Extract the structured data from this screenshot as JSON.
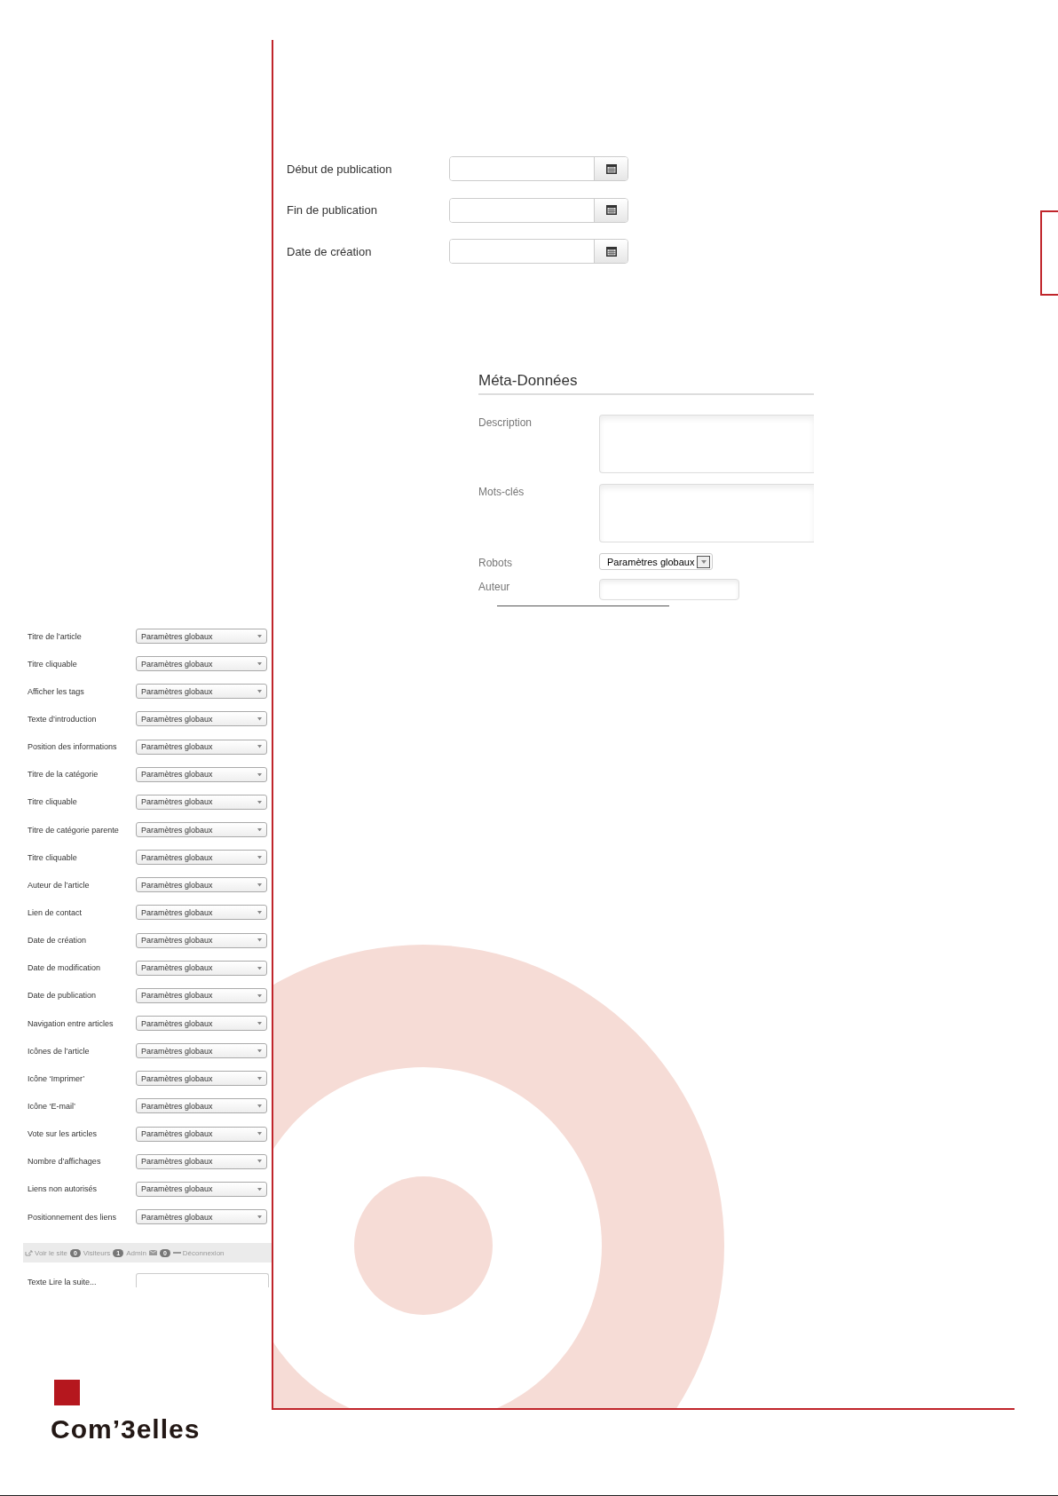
{
  "publishing": [
    {
      "label": "Début de publication"
    },
    {
      "label": "Fin de publication"
    },
    {
      "label": "Date de création"
    }
  ],
  "metadata": {
    "title": "Méta-Données",
    "fields": [
      {
        "kind": "textarea",
        "label": "Description"
      },
      {
        "kind": "textarea",
        "label": "Mots-clés"
      },
      {
        "kind": "select",
        "label": "Robots",
        "value": "Paramètres globaux"
      },
      {
        "kind": "input",
        "label": "Auteur"
      }
    ]
  },
  "options": [
    {
      "label": "Titre de l’article",
      "value": "Paramètres globaux"
    },
    {
      "label": "Titre cliquable",
      "value": "Paramètres globaux"
    },
    {
      "label": "Afficher les tags",
      "value": "Paramètres globaux"
    },
    {
      "label": "Texte d’introduction",
      "value": "Paramètres globaux"
    },
    {
      "label": "Position des informations",
      "value": "Paramètres globaux"
    },
    {
      "label": "Titre de la catégorie",
      "value": "Paramètres globaux"
    },
    {
      "label": "Titre cliquable",
      "value": "Paramètres globaux"
    },
    {
      "label": "Titre de catégorie parente",
      "value": "Paramètres globaux"
    },
    {
      "label": "Titre cliquable",
      "value": "Paramètres globaux"
    },
    {
      "label": "Auteur de l’article",
      "value": "Paramètres globaux"
    },
    {
      "label": "Lien de contact",
      "value": "Paramètres globaux"
    },
    {
      "label": "Date de création",
      "value": "Paramètres globaux"
    },
    {
      "label": "Date de modification",
      "value": "Paramètres globaux"
    },
    {
      "label": "Date de publication",
      "value": "Paramètres globaux"
    },
    {
      "label": "Navigation entre articles",
      "value": "Paramètres globaux"
    },
    {
      "label": "Icônes de l’article",
      "value": "Paramètres globaux"
    },
    {
      "label": "Icône ‘Imprimer’",
      "value": "Paramètres globaux"
    },
    {
      "label": "Icône ‘E-mail’",
      "value": "Paramètres globaux"
    },
    {
      "label": "Vote sur les articles",
      "value": "Paramètres globaux"
    },
    {
      "label": "Nombre d’affichages",
      "value": "Paramètres globaux"
    },
    {
      "label": "Liens non autorisés",
      "value": "Paramètres globaux"
    },
    {
      "label": "Positionnement des liens",
      "value": "Paramètres globaux"
    }
  ],
  "admin_bar": {
    "items": [
      {
        "kind": "site-link",
        "label": "Voir le site"
      },
      {
        "kind": "badge",
        "label": "0"
      },
      {
        "kind": "text",
        "label": "Visiteurs"
      },
      {
        "kind": "badge",
        "label": "1"
      },
      {
        "kind": "text",
        "label": "Admin"
      },
      {
        "kind": "mail"
      },
      {
        "kind": "badge",
        "label": "0"
      },
      {
        "kind": "logout",
        "label": "Déconnexion"
      }
    ]
  },
  "read_more": {
    "label": "Texte Lire la suite..."
  },
  "logo": {
    "text": "Com’3elles"
  }
}
